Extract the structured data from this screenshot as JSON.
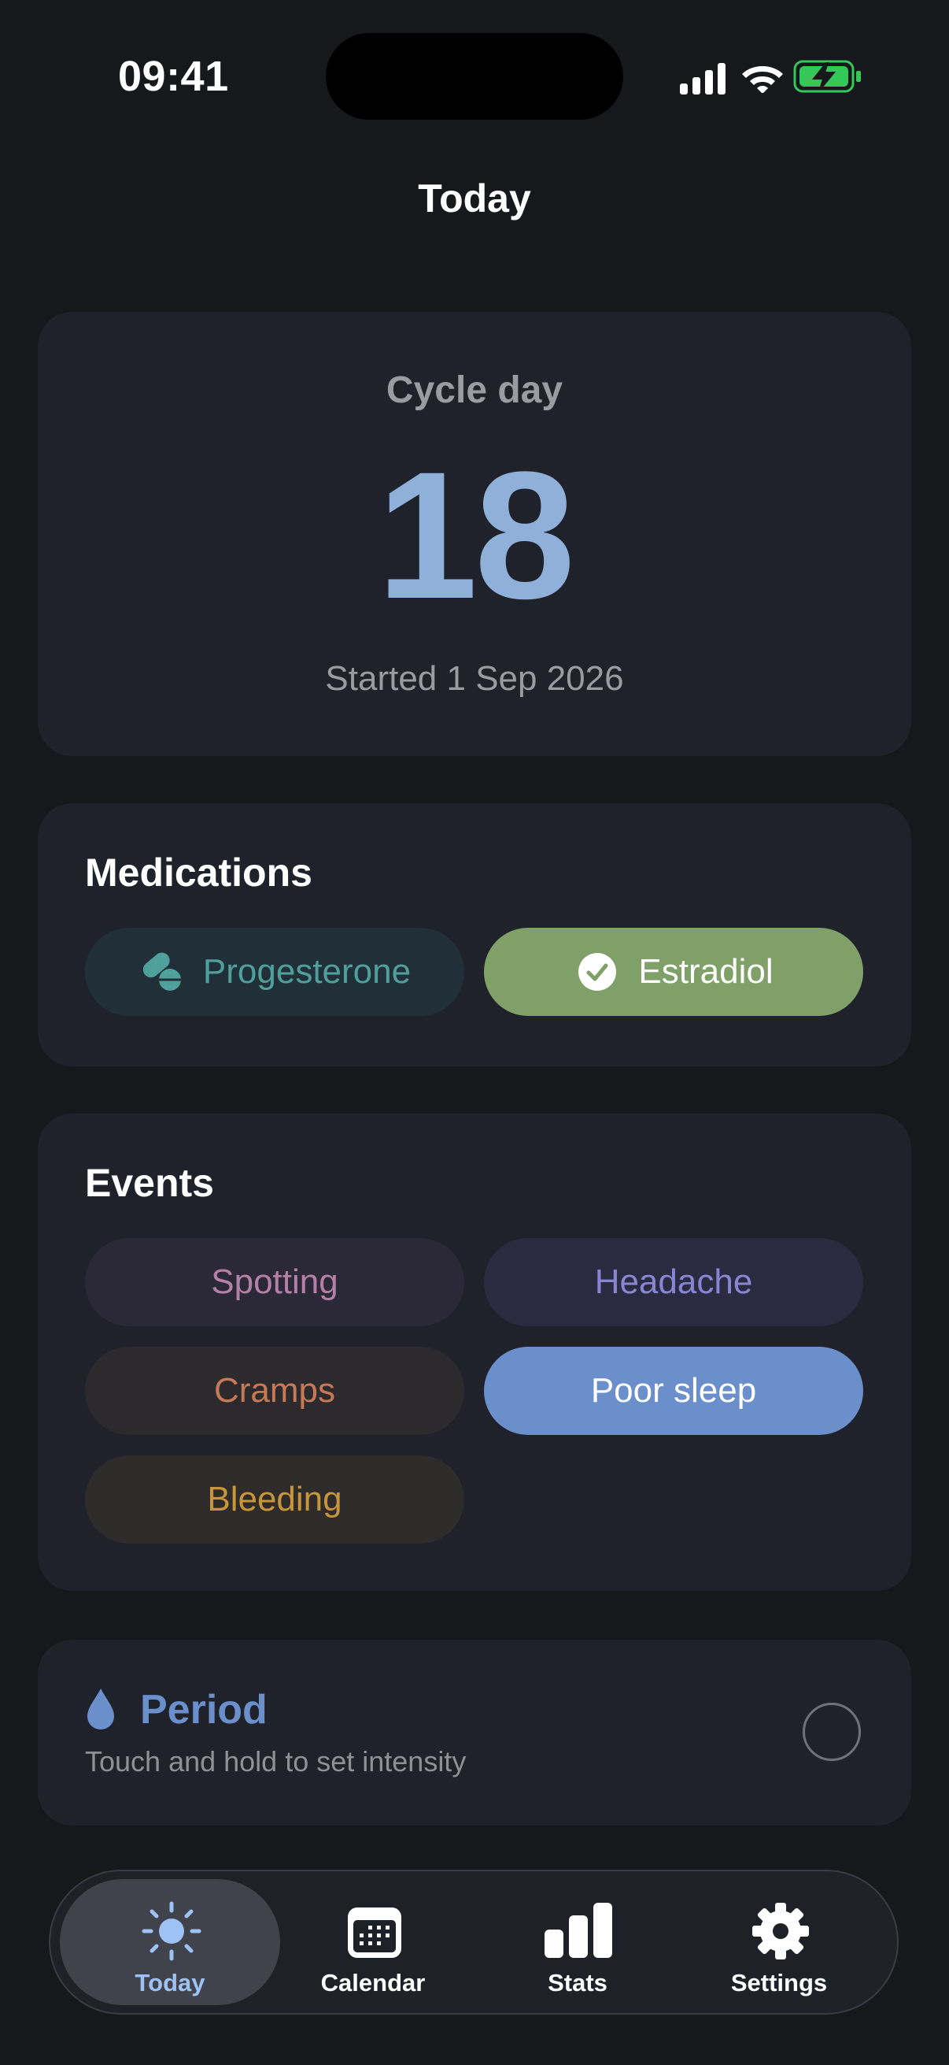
{
  "status_bar": {
    "time": "09:41",
    "icons": [
      "cellular-signal-icon",
      "wifi-icon",
      "battery-charging-icon"
    ]
  },
  "header": {
    "title": "Today"
  },
  "cycle": {
    "label": "Cycle day",
    "day": "18",
    "started": "Started 1 Sep 2026"
  },
  "medications": {
    "title": "Medications",
    "items": [
      {
        "label": "Progesterone",
        "icon": "pill-icon",
        "selected": false,
        "color": "#4f9f9c"
      },
      {
        "label": "Estradiol",
        "icon": "checkmark-circle-icon",
        "selected": true,
        "color": "#7fa068"
      }
    ]
  },
  "events": {
    "title": "Events",
    "items": [
      {
        "label": "Spotting",
        "selected": false,
        "color": "#b580a8"
      },
      {
        "label": "Headache",
        "selected": false,
        "color": "#8a85d2"
      },
      {
        "label": "Cramps",
        "selected": false,
        "color": "#c57a55"
      },
      {
        "label": "Poor sleep",
        "selected": true,
        "color": "#6b8fcb"
      },
      {
        "label": "Bleeding",
        "selected": false,
        "color": "#c8953a"
      }
    ]
  },
  "period": {
    "title": "Period",
    "subtitle": "Touch and hold to set intensity",
    "icon": "drop-icon",
    "checked": false,
    "color": "#6b8fcb"
  },
  "tab_bar": {
    "active": "Today",
    "tabs": [
      {
        "label": "Today",
        "icon": "sun-icon"
      },
      {
        "label": "Calendar",
        "icon": "calendar-icon"
      },
      {
        "label": "Stats",
        "icon": "bar-chart-icon"
      },
      {
        "label": "Settings",
        "icon": "gear-icon"
      }
    ]
  },
  "colors": {
    "background": "#17181c",
    "card": "#1f222a",
    "accent": "#8fb0d8"
  }
}
